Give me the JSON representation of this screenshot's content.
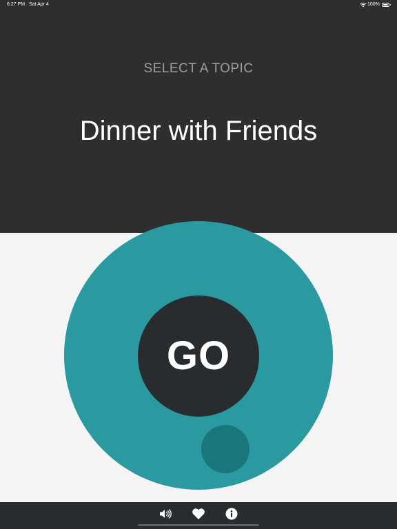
{
  "status_bar": {
    "time": "6:27 PM",
    "date": "Sat Apr 4",
    "battery": "100%"
  },
  "header": {
    "subtitle": "SELECT A TOPIC",
    "topic": "Dinner with Friends"
  },
  "wheel": {
    "go_label": "GO"
  },
  "toolbar": {
    "icons": [
      "speaker-icon",
      "heart-icon",
      "info-icon"
    ]
  },
  "colors": {
    "top_panel": "#2e2d30",
    "background": "#f4f4f5",
    "accent_teal": "#2a9aa0",
    "knob_teal": "#1a767d",
    "dark": "#282c2f"
  }
}
